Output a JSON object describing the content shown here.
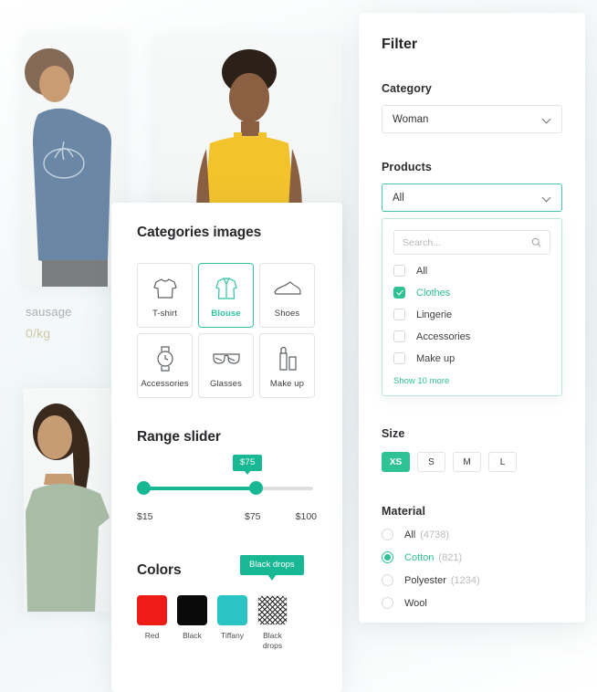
{
  "gallery": {
    "product_label": "sausage",
    "product_price": "0/kg",
    "photos": [
      {
        "alt": "man-in-blue-adidas-tshirt"
      },
      {
        "alt": "woman-in-yellow-top"
      },
      {
        "alt": "woman-in-sage-green-tshirt"
      }
    ]
  },
  "categories_panel": {
    "title": "Categories images",
    "tiles": [
      {
        "label": "T-shirt",
        "icon": "tshirt-icon",
        "active": false
      },
      {
        "label": "Blouse",
        "icon": "blouse-icon",
        "active": true
      },
      {
        "label": "Shoes",
        "icon": "shoe-icon",
        "active": false
      },
      {
        "label": "Accessories",
        "icon": "watch-icon",
        "active": false
      },
      {
        "label": "Glasses",
        "icon": "glasses-icon",
        "active": false
      },
      {
        "label": "Make up",
        "icon": "lipstick-icon",
        "active": false
      }
    ],
    "range": {
      "title": "Range slider",
      "tooltip": "$75",
      "min_label": "$15",
      "current_label": "$75",
      "max_label": "$100",
      "min": 15,
      "current": 75,
      "max": 100
    },
    "colors": {
      "title": "Colors",
      "tooltip": "Black drops",
      "swatches": [
        {
          "label": "Red",
          "hex": "#ED1C16"
        },
        {
          "label": "Black",
          "hex": "#0A0A0A"
        },
        {
          "label": "Tiffany",
          "hex": "#2BC4C4"
        },
        {
          "label": "Black drops",
          "hex": "pattern"
        }
      ]
    }
  },
  "filter_panel": {
    "title": "Filter",
    "category": {
      "label": "Category",
      "value": "Woman",
      "icon": "chevron-down-icon"
    },
    "products": {
      "label": "Products",
      "value": "All",
      "icon": "chevron-down-icon",
      "search_placeholder": "Search...",
      "search_value": "",
      "search_icon": "search-icon",
      "options": [
        {
          "label": "All",
          "checked": false
        },
        {
          "label": "Clothes",
          "checked": true
        },
        {
          "label": "Lingerie",
          "checked": false
        },
        {
          "label": "Accessories",
          "checked": false
        },
        {
          "label": "Make up",
          "checked": false
        }
      ],
      "show_more": "Show 10 more"
    },
    "size": {
      "label": "Size",
      "options": [
        {
          "label": "XS",
          "active": true
        },
        {
          "label": "S",
          "active": false
        },
        {
          "label": "M",
          "active": false
        },
        {
          "label": "L",
          "active": false
        }
      ]
    },
    "material": {
      "label": "Material",
      "options": [
        {
          "label": "All",
          "count": "(4738)",
          "selected": false
        },
        {
          "label": "Cotton",
          "count": "(821)",
          "selected": true
        },
        {
          "label": "Polyester",
          "count": "(1234)",
          "selected": false
        },
        {
          "label": "Wool",
          "count": "",
          "selected": false
        }
      ]
    }
  },
  "theme": {
    "accent": "#2ec295",
    "accent_dark": "#19b894",
    "text": "#2b2d30",
    "muted": "#b9bcbf"
  }
}
